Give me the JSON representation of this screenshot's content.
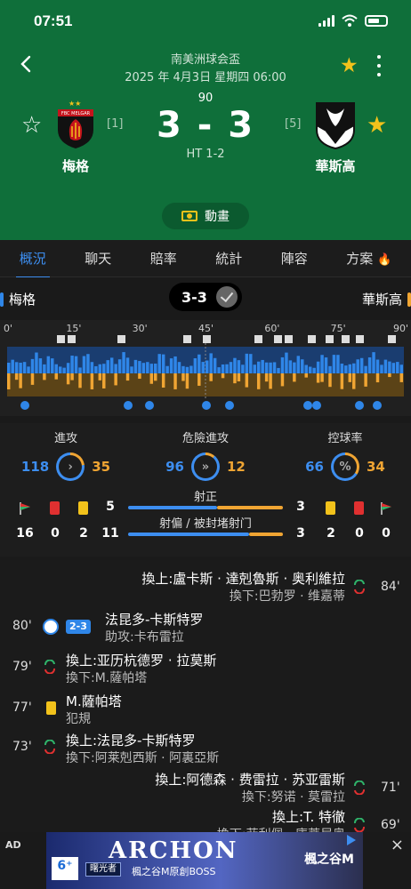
{
  "status_bar": {
    "time": "07:51"
  },
  "match": {
    "league": "南美洲球会盃",
    "datetime": "2025 年 4月3日 星期四 06:00",
    "minute": "90",
    "score": "3 - 3",
    "halftime": "HT 1-2",
    "home": {
      "name": "梅格",
      "rank": "[1]",
      "crest_text": "FBC MELGAR"
    },
    "away": {
      "name": "華斯高",
      "rank": "[5]"
    },
    "animation_label": "動畫"
  },
  "tabs": [
    {
      "label": "概況",
      "active": true
    },
    {
      "label": "聊天"
    },
    {
      "label": "賠率"
    },
    {
      "label": "統計"
    },
    {
      "label": "陣容"
    },
    {
      "label": "方案"
    }
  ],
  "scorebar": {
    "home": "梅格",
    "score": "3-3",
    "away": "華斯高"
  },
  "timeline": {
    "ticks": [
      "0'",
      "15'",
      "30'",
      "45'",
      "60'",
      "75'",
      "90'"
    ]
  },
  "stats": {
    "attack": {
      "label": "進攻",
      "home": "118",
      "away": "35"
    },
    "dangerous": {
      "label": "危險進攻",
      "home": "96",
      "away": "12"
    },
    "possession": {
      "label": "控球率",
      "home": "66",
      "away": "34",
      "icon": "%"
    },
    "shots_on_label": "射正",
    "shots_off_label": "射偏 / 被封堵射门",
    "home_corners": "16",
    "home_red": "0",
    "home_yellow": "2",
    "home_shots_on": "5",
    "home_shots_off": "11",
    "away_shots_on": "3",
    "away_shots_off": "3",
    "away_yellow": "2",
    "away_red": "0",
    "away_corners": "0",
    "away_top_yellow": "3"
  },
  "events": [
    {
      "side": "away",
      "minute": "84'",
      "main": "換上:盧卡斯 · 達剋魯斯 · 奥利維拉",
      "sub": "換下:巴勃罗 · 维嘉蒂"
    },
    {
      "side": "home",
      "minute": "80'",
      "type": "goal",
      "badge": "2-3",
      "main": "法昆多-卡斯特罗",
      "sub": "助攻:卡布雷拉"
    },
    {
      "side": "home",
      "minute": "79'",
      "main": "換上:亚历杭德罗 · 拉莫斯",
      "sub": "換下:M.薩帕塔"
    },
    {
      "side": "home",
      "minute": "77'",
      "type": "yellow",
      "main": "M.薩帕塔",
      "sub": "犯規"
    },
    {
      "side": "home",
      "minute": "73'",
      "main": "換上:法昆多-卡斯特罗",
      "sub": "換下:阿莱剋西斯 · 阿裏亞斯"
    },
    {
      "side": "away",
      "minute": "71'",
      "main": "換上:阿德森 · 费雷拉 · 苏亚雷斯",
      "sub": "換下:努诺 · 莫雷拉"
    },
    {
      "side": "away",
      "minute": "69'",
      "main": "換上:T. 特徹",
      "sub": "換下:菲利佩 · 庫蒂尼奥"
    }
  ],
  "ad": {
    "label": "AD",
    "title": "ARCHON",
    "tag": "曙光者",
    "subtitle": "楓之谷M原創BOSS",
    "logo": "6⁺",
    "brand": "楓之谷M",
    "close": "×"
  },
  "colors": {
    "home": "#2f86e8",
    "away": "#f0a533",
    "header": "#0f6f3a",
    "accent": "#f2c21b"
  }
}
